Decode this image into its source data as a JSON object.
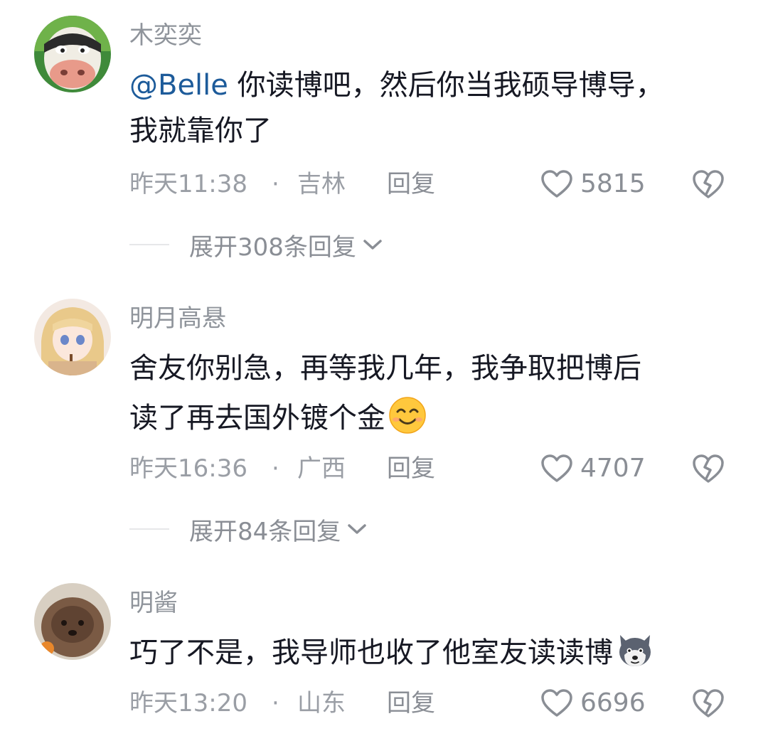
{
  "comments": [
    {
      "username": "木奕奕",
      "mention": "@Belle",
      "line1": " 你读博吧，然后你当我硕导博导，",
      "line2": "我就靠你了",
      "time": "昨天11:38",
      "dot": "·",
      "location": "吉林",
      "reply_label": "回复",
      "likes": "5815",
      "expand_label": "展开308条回复"
    },
    {
      "username": "明月高悬",
      "line1": "舍友你别急，再等我几年，我争取把博后",
      "line2": "读了再去国外镀个金",
      "emoji": "smiling-face-emoji",
      "time": "昨天16:36",
      "dot": "·",
      "location": "广西",
      "reply_label": "回复",
      "likes": "4707",
      "expand_label": "展开84条回复"
    },
    {
      "username": "明酱",
      "line1": "巧了不是，我导师也收了他室友读读博",
      "emoji": "husky-dog-emoji",
      "time": "昨天13:20",
      "dot": "·",
      "location": "山东",
      "reply_label": "回复",
      "likes": "6696"
    }
  ],
  "colors": {
    "mention": "#1d5b9a",
    "meta_text": "#9a9ea5",
    "body_text": "#161823"
  }
}
